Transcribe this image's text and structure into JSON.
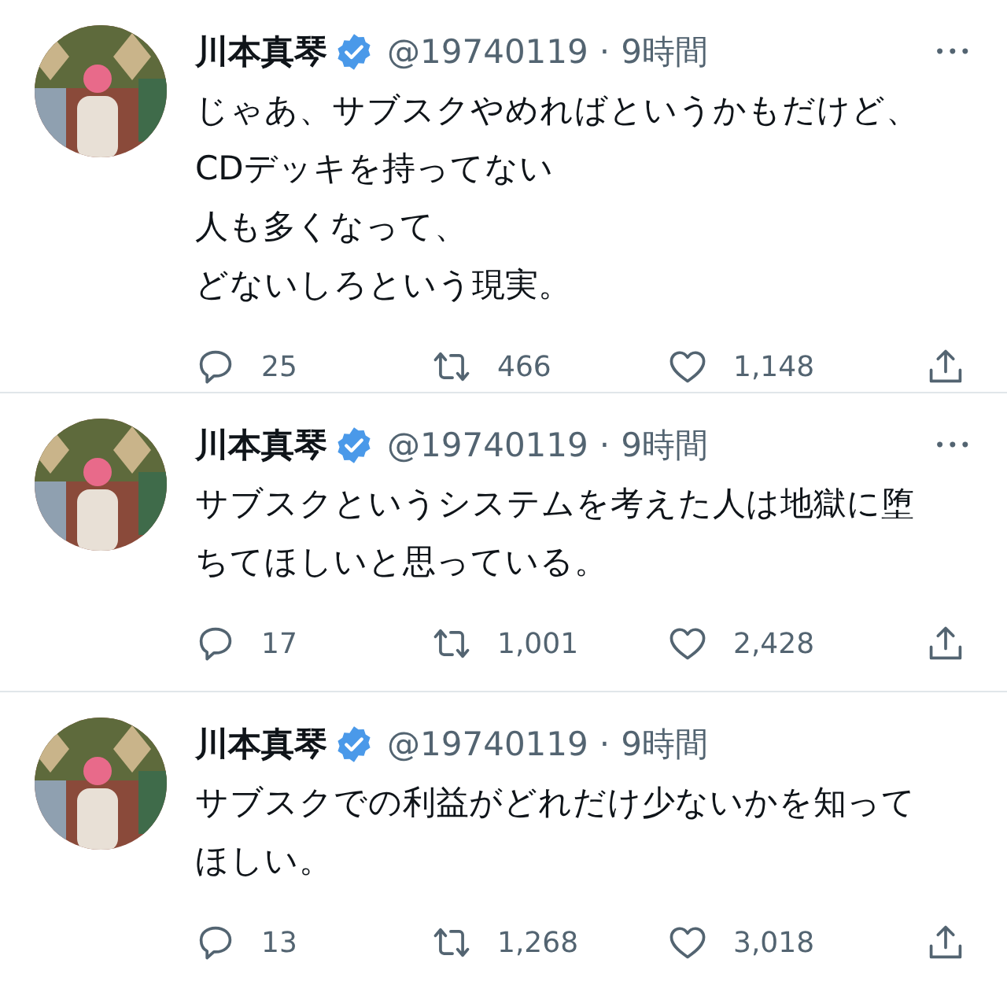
{
  "tweets": [
    {
      "name": "川本真琴",
      "verified": true,
      "handle": "@19740119",
      "dot": "·",
      "time": "9時間",
      "more": "•••",
      "lines": [
        "じゃあ、サブスクやめればというかもだけど、",
        "CDデッキを持ってない",
        "人も多くなって、",
        "どないしろという現実。"
      ],
      "replies": "25",
      "retweets": "466",
      "likes": "1,148"
    },
    {
      "name": "川本真琴",
      "verified": true,
      "handle": "@19740119",
      "dot": "·",
      "time": "9時間",
      "more": "•••",
      "lines": [
        "サブスクというシステムを考えた人は地獄に堕",
        "ちてほしいと思っている。"
      ],
      "replies": "17",
      "retweets": "1,001",
      "likes": "2,428"
    },
    {
      "name": "川本真琴",
      "verified": true,
      "handle": "@19740119",
      "dot": "·",
      "time": "9時間",
      "lines": [
        "サブスクでの利益がどれだけ少ないかを知って",
        "ほしい。"
      ],
      "replies": "13",
      "retweets": "1,268",
      "likes": "3,018"
    }
  ]
}
